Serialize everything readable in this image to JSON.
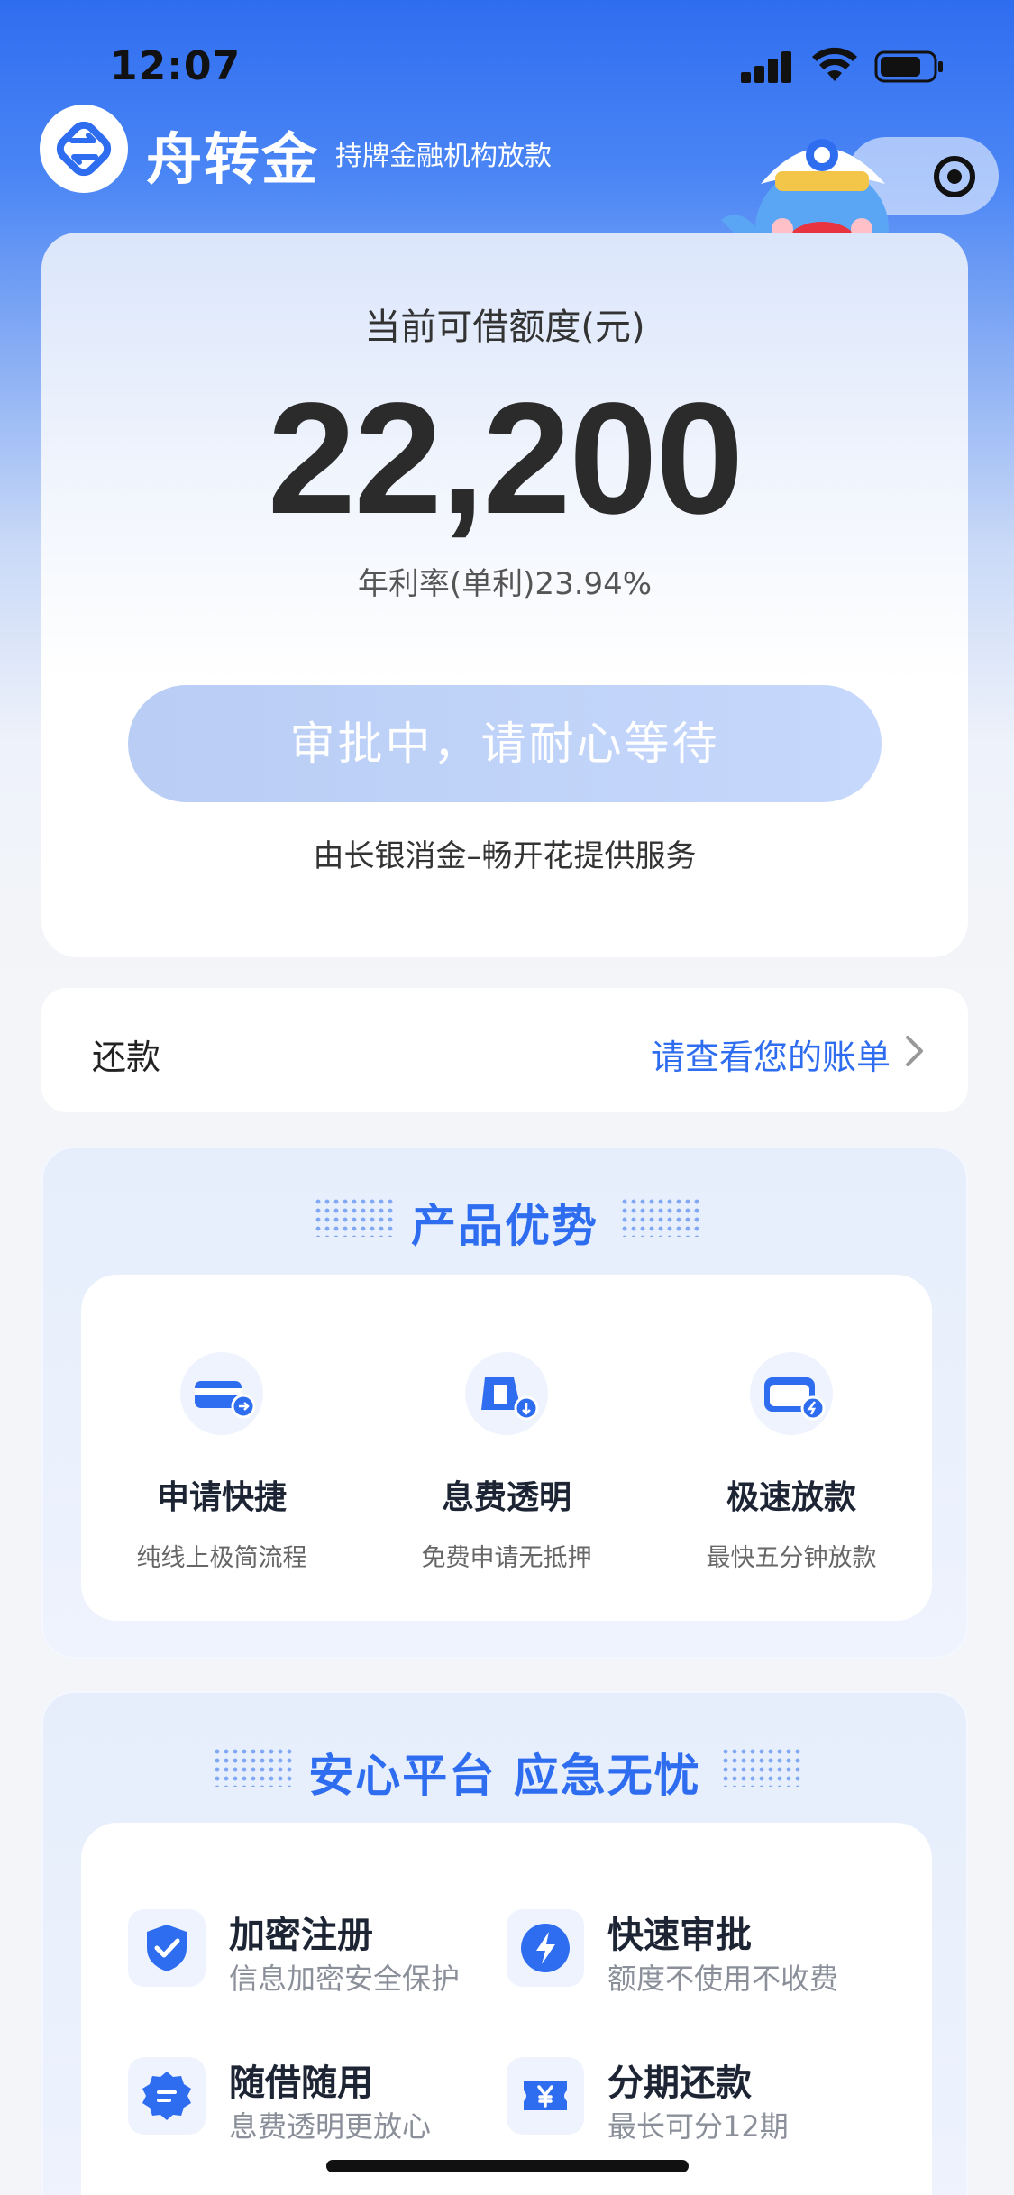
{
  "status_bar": {
    "time": "12:07"
  },
  "header": {
    "brand": "舟转金",
    "tagline": "持牌金融机构放款"
  },
  "credit": {
    "label": "当前可借额度(元)",
    "amount": "22,200",
    "rate": "年利率(单利)23.94%",
    "status_button": "审批中，请耐心等待",
    "provider": "由长银消金–畅开花提供服务"
  },
  "repay": {
    "label": "还款",
    "link": "请查看您的账单"
  },
  "advantages": {
    "title": "产品优势",
    "items": [
      {
        "title": "申请快捷",
        "desc": "纯线上极简流程",
        "icon": "card-icon"
      },
      {
        "title": "息费透明",
        "desc": "免费申请无抵押",
        "icon": "fee-icon"
      },
      {
        "title": "极速放款",
        "desc": "最快五分钟放款",
        "icon": "wallet-icon"
      }
    ]
  },
  "platform": {
    "title": "安心平台 应急无忧",
    "items": [
      {
        "title": "加密注册",
        "desc": "信息加密安全保护",
        "icon": "shield-check-icon"
      },
      {
        "title": "快速审批",
        "desc": "额度不使用不收费",
        "icon": "lightning-icon"
      },
      {
        "title": "随借随用",
        "desc": "息费透明更放心",
        "icon": "badge-icon"
      },
      {
        "title": "分期还款",
        "desc": "最长可分12期",
        "icon": "yen-ticket-icon"
      }
    ]
  },
  "colors": {
    "brand_blue": "#2f6df0",
    "button_disabled": "#c0d3f8"
  }
}
